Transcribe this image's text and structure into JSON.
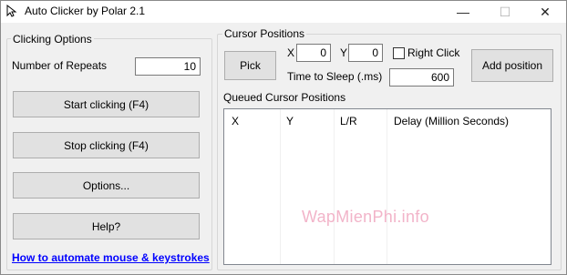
{
  "window": {
    "title": "Auto Clicker by Polar 2.1",
    "min_glyph": "—",
    "max_glyph": "☐",
    "close_glyph": "✕"
  },
  "clicking_options": {
    "group_label": "Clicking Options",
    "repeats_label": "Number of Repeats",
    "repeats_value": "10",
    "start_label": "Start clicking (F4)",
    "stop_label": "Stop clicking (F4)",
    "options_label": "Options...",
    "help_label": "Help?",
    "link_text": "How to automate mouse & keystrokes"
  },
  "cursor_positions": {
    "group_label": "Cursor Positions",
    "pick_label": "Pick",
    "x_label": "X",
    "x_value": "0",
    "y_label": "Y",
    "y_value": "0",
    "right_click_label": "Right Click",
    "right_click_checked": false,
    "sleep_label": "Time to Sleep (.ms)",
    "sleep_value": "600",
    "add_label": "Add position"
  },
  "queue": {
    "label": "Queued Cursor Positions",
    "columns": [
      "X",
      "Y",
      "L/R",
      "Delay (Million Seconds)"
    ]
  },
  "watermark": "WapMienPhi.info",
  "colors": {
    "link": "#0000ff",
    "watermark": "#f2b4c9",
    "button_face": "#e1e1e1"
  }
}
